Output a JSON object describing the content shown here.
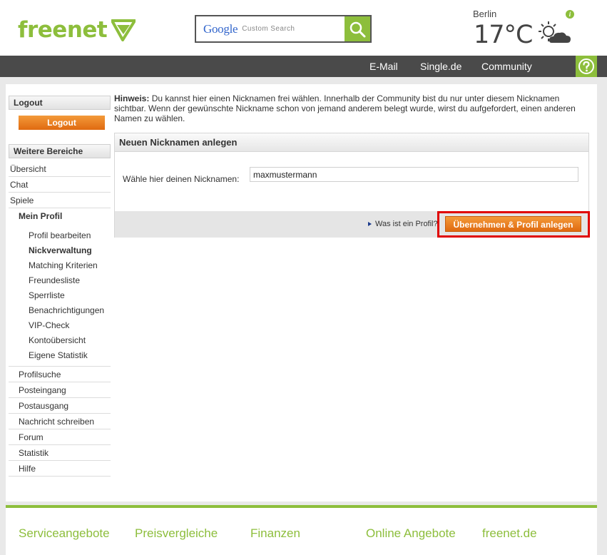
{
  "header": {
    "logo_text": "freenet",
    "search": {
      "brand": "Google",
      "placeholder": "Custom Search"
    },
    "weather": {
      "city": "Berlin",
      "temperature": "17°C",
      "icon": "sun-cloud-icon",
      "info_label": "i"
    }
  },
  "nav": {
    "links": [
      "E-Mail",
      "Single.de",
      "Community"
    ],
    "help_icon": "help-question-icon"
  },
  "sidebar": {
    "logout_heading": "Logout",
    "logout_button": "Logout",
    "areas_heading": "Weitere Bereiche",
    "items_top": [
      "Übersicht",
      "Chat",
      "Spiele"
    ],
    "profile_heading": "Mein Profil",
    "profile_sub": [
      "Profil bearbeiten",
      "Nickverwaltung",
      "Matching Kriterien",
      "Freundesliste",
      "Sperrliste",
      "Benachrichtigungen",
      "VIP-Check",
      "Kontoübersicht",
      "Eigene Statistik"
    ],
    "items_bottom": [
      "Profilsuche",
      "Posteingang",
      "Postausgang",
      "Nachricht schreiben",
      "Forum",
      "Statistik",
      "Hilfe"
    ]
  },
  "main": {
    "hint_label": "Hinweis:",
    "hint_text": "Du kannst hier einen Nicknamen frei wählen. Innerhalb der Community bist du nur unter diesem Nicknamen sichtbar. Wenn der gewünschte Nickname schon von jemand anderem belegt wurde, wirst du aufgefordert, einen anderen Namen zu wählen.",
    "panel_title": "Neuen Nicknamen anlegen",
    "field_label": "Wähle hier deinen Nicknamen:",
    "field_value": "maxmustermann",
    "profile_link": "Was ist ein Profil?",
    "submit_button": "Übernehmen & Profil anlegen"
  },
  "footer": {
    "links": [
      "Serviceangebote",
      "Preisvergleiche",
      "Finanzen",
      "Online Angebote",
      "freenet.de"
    ]
  },
  "colors": {
    "brand_green": "#8dbe3c",
    "nav_gray": "#4a4a4a",
    "button_orange": "#e06a10",
    "highlight_red": "#e00000"
  }
}
